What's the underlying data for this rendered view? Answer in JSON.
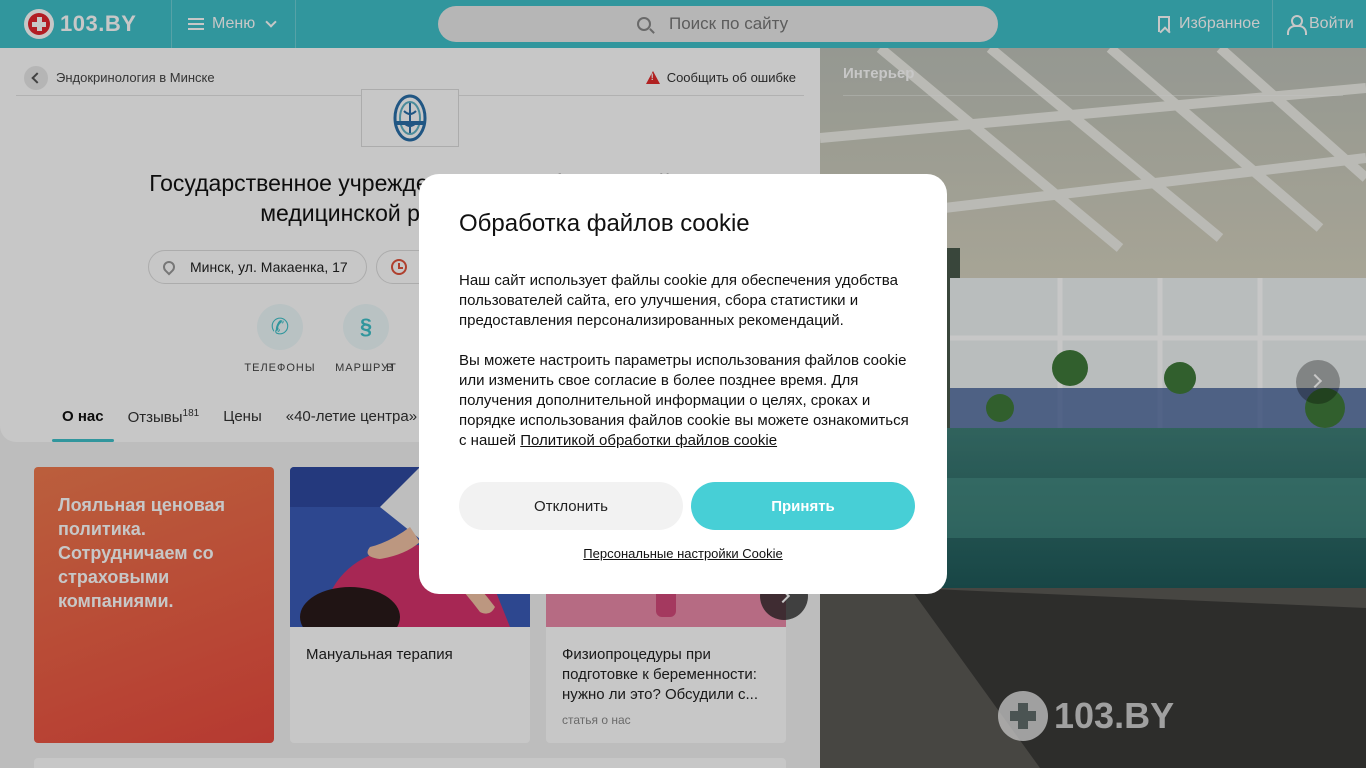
{
  "header": {
    "logo_text": "103.BY",
    "menu_label": "Меню",
    "search_placeholder": "Поиск по сайту",
    "favorites_label": "Избранное",
    "login_label": "Войти"
  },
  "page": {
    "breadcrumb": "Эндокринология в Минске",
    "report_error": "Сообщить об ошибке",
    "title_line1": "Государственное учреждение «Республиканский",
    "title_line2": "медицинской реабилитации",
    "address": "Минск, ул. Макаенка, 17",
    "actions": [
      {
        "label": "ТЕЛЕФОНЫ",
        "icon": "phone-icon"
      },
      {
        "label": "МАРШРУТ",
        "icon": "route-icon"
      },
      {
        "label": "В",
        "icon": "more-icon"
      }
    ],
    "tabs": [
      {
        "label": "О нас",
        "active": true
      },
      {
        "label": "Отзывы",
        "count": "181"
      },
      {
        "label": "Цены"
      },
      {
        "label": "«40-летие центра»"
      }
    ]
  },
  "cards": {
    "promo_text": "Лояльная ценовая политика. Сотрудничаем со страховыми компаниями.",
    "card1_title": "Мануальная терапия",
    "card2_title": "Физиопроцедуры при подготовке к беременности: нужно ли это? Обсудили с...",
    "card2_sub": "статья о нас"
  },
  "gallery": {
    "title": "Интерьер",
    "watermark": "103.BY"
  },
  "cookie_dialog": {
    "title": "Обработка файлов cookie",
    "paragraph1": "Наш сайт использует файлы cookie для обеспечения удобства пользователей сайта, его улучшения, сбора статистики и предоставления персонализированных рекомендаций.",
    "paragraph2": "Вы можете настроить параметры использования файлов cookie или изменить свое согласие в более позднее время. Для получения дополнительной информации о целях, сроках и порядке использования файлов cookie вы можете ознакомиться с нашей",
    "policy_link": "Политикой обработки файлов cookie",
    "decline_label": "Отклонить",
    "accept_label": "Принять",
    "settings_link": "Персональные настройки Cookie"
  },
  "colors": {
    "brand": "#3fc1c9",
    "accept_button": "#47cfd6",
    "promo_card": "#ea4a3f",
    "logo_red": "#e5262f"
  }
}
